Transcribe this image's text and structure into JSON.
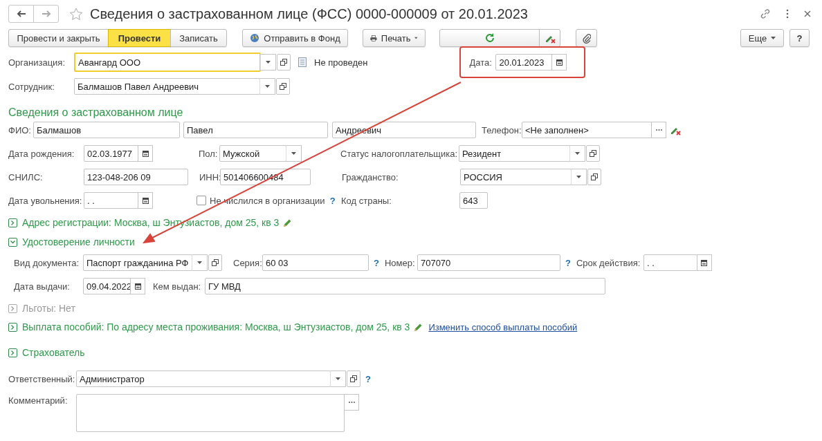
{
  "window": {
    "title": "Сведения о застрахованном лице (ФСС) 0000-000009 от 20.01.2023"
  },
  "toolbar": {
    "buttons": [
      {
        "label": "Провести и закрыть",
        "primary": false
      },
      {
        "label": "Провести",
        "primary": true
      },
      {
        "label": "Записать",
        "primary": false
      }
    ],
    "send_button": "Отправить в Фонд",
    "print_button": "Печать",
    "more_button": "Еще",
    "help_button": "?"
  },
  "organization": {
    "label": "Организация:",
    "value": "Авангард ООО",
    "kind": "select",
    "focused": true
  },
  "posting_status": "Не проведен",
  "date": {
    "label": "Дата:",
    "value": "20.01.2023",
    "kind": "date",
    "highlighted": true
  },
  "employee": {
    "label": "Сотрудник:",
    "value": "Балмашов Павел Андреевич",
    "kind": "select",
    "focused": false
  },
  "section_title": "Сведения о застрахованном лице",
  "last_name": {
    "label": "ФИО:",
    "value": "Балмашов"
  },
  "first_name": {
    "value": "Павел"
  },
  "middle_name": {
    "value": "Андреевич"
  },
  "phone": {
    "label": "Телефон:",
    "value": "<Не заполнен>",
    "kind": "picker"
  },
  "birth_date": {
    "label": "Дата рождения:",
    "value": "02.03.1977",
    "kind": "date"
  },
  "gender": {
    "label": "Пол:",
    "value": "Мужской",
    "kind": "choice"
  },
  "taxpayer_status": {
    "label": "Статус налогоплательщика:",
    "value": "Резидент",
    "kind": "select"
  },
  "snils": {
    "label": "СНИЛС:",
    "value": "123-048-206 09"
  },
  "inn": {
    "label": "ИНН:",
    "value": "501406600484"
  },
  "citizenship": {
    "label": "Гражданство:",
    "value": "РОССИЯ",
    "kind": "select"
  },
  "dismissal_date": {
    "label": "Дата увольнения:",
    "value": ". .",
    "kind": "date"
  },
  "not_employed": {
    "label": "Не числился в организации",
    "checked": false,
    "help": "?"
  },
  "country_code": {
    "label": "Код страны:",
    "value": "643"
  },
  "groups": [
    {
      "label": "Адрес регистрации: Москва, ш Энтузиастов, дом 25, кв 3",
      "expanded": false,
      "disabled": false,
      "editable": true
    },
    {
      "label": "Удостоверение личности",
      "expanded": true,
      "disabled": false,
      "editable": false
    }
  ],
  "identity": {
    "doc_type": {
      "label": "Вид документа:",
      "value": "Паспорт гражданина РФ",
      "kind": "select"
    },
    "series": {
      "label": "Серия:",
      "value": "60 03",
      "help": "?"
    },
    "number": {
      "label": "Номер:",
      "value": "707070",
      "help": "?"
    },
    "valid_until": {
      "label": "Срок действия:",
      "value": ". .",
      "kind": "date"
    },
    "issue_date": {
      "label": "Дата выдачи:",
      "value": "09.04.2022",
      "kind": "date"
    },
    "issued_by": {
      "label": "Кем выдан:",
      "value": "ГУ МВД"
    }
  },
  "more_groups": [
    {
      "label": "Льготы: Нет",
      "expanded": false,
      "disabled": true,
      "editable": false
    },
    {
      "label": "Выплата пособий: По адресу места проживания: Москва, ш Энтузиастов, дом 25, кв 3",
      "expanded": false,
      "disabled": false,
      "editable": true,
      "link": "Изменить способ выплаты пособий"
    },
    {
      "label": "Страхователь",
      "expanded": false,
      "disabled": false,
      "editable": false
    }
  ],
  "responsible": {
    "label": "Ответственный:",
    "value": "Администратор",
    "kind": "select",
    "help": "?"
  },
  "comment": {
    "label": "Комментарий:",
    "kind": "picker"
  }
}
